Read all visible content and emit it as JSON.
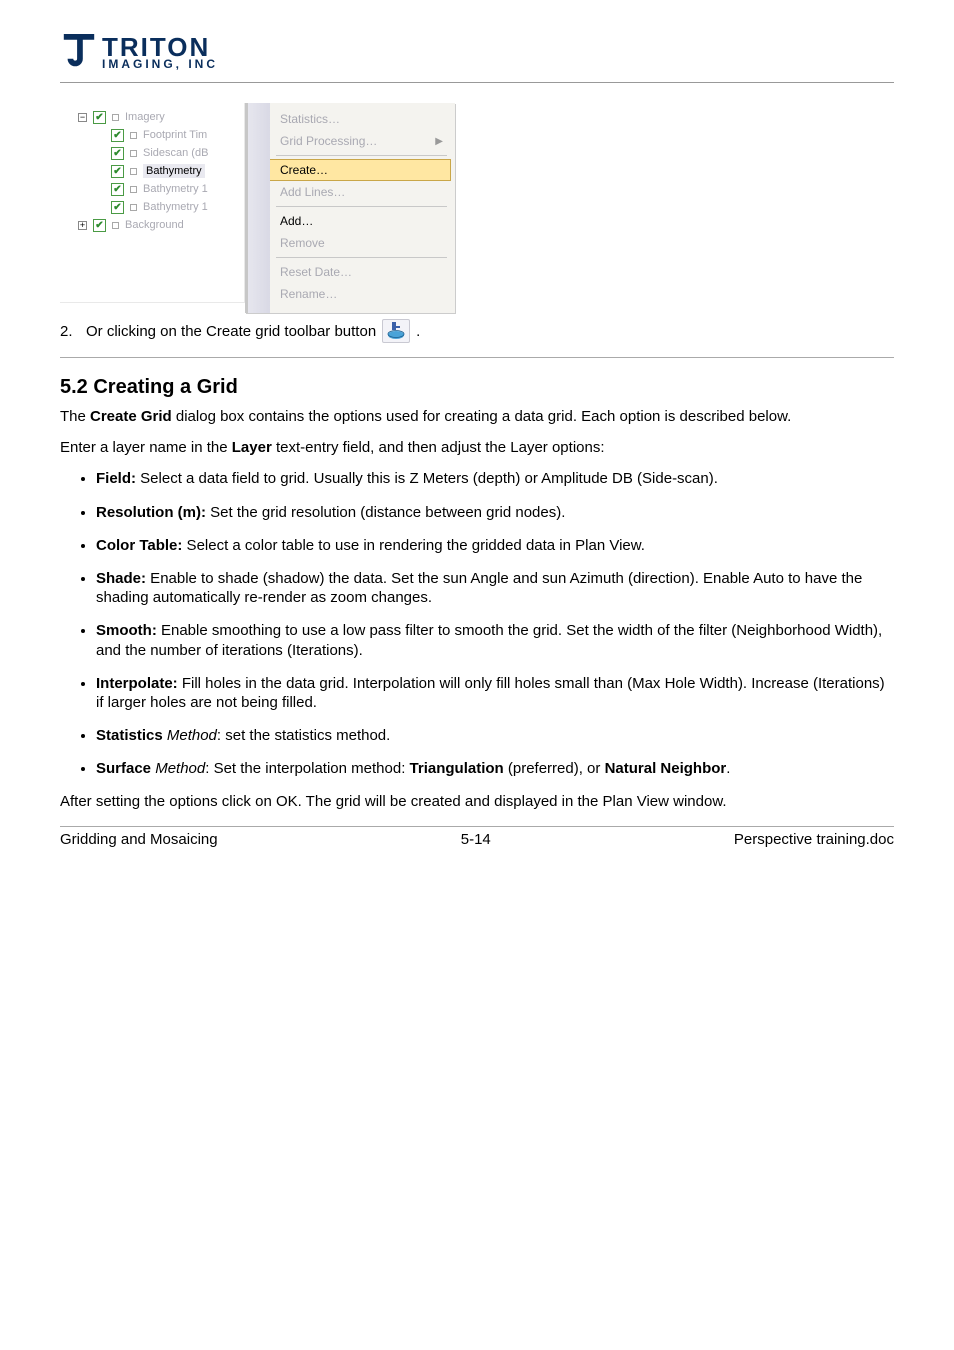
{
  "logo": {
    "main": "TRITON",
    "sub": "IMAGING, INC"
  },
  "tree": {
    "items": [
      {
        "label": "Imagery",
        "toggle": "−",
        "indent": 1
      },
      {
        "label": "Footprint Tim",
        "indent": 2
      },
      {
        "label": "Sidescan (dB",
        "indent": 2
      },
      {
        "label": "Bathymetry",
        "indent": 2,
        "highlight": true
      },
      {
        "label": "Bathymetry 1",
        "indent": 2
      },
      {
        "label": "Bathymetry 1",
        "indent": 2
      },
      {
        "label": "Background",
        "toggle": "+",
        "indent": 1
      }
    ]
  },
  "menu": {
    "items": [
      {
        "label": "Statistics…",
        "enabled": false
      },
      {
        "label": "Grid Processing…",
        "enabled": false,
        "submenu": true
      },
      {
        "sep": true
      },
      {
        "label": "Create…",
        "enabled": true,
        "highlight": true
      },
      {
        "label": "Add Lines…",
        "enabled": false
      },
      {
        "sep": true
      },
      {
        "label": "Add…",
        "enabled": true
      },
      {
        "label": "Remove",
        "enabled": false
      },
      {
        "sep": true
      },
      {
        "label": "Reset Date…",
        "enabled": false
      },
      {
        "label": "Rename…",
        "enabled": false
      }
    ]
  },
  "step2": {
    "num": "2.",
    "text_before": "Or clicking on the Create grid toolbar button ",
    "text_after": "."
  },
  "section": {
    "heading": "5.2 Creating a Grid",
    "p1_a": "The ",
    "p1_b": "Create Grid",
    "p1_c": " dialog box contains the options used for creating a data grid. Each option is described below.",
    "p2_a": "Enter a layer name in the ",
    "p2_b": "Layer",
    "p2_c": " text-entry field, and then adjust the Layer options:",
    "p3": "After setting the options click on OK. The grid will be created and displayed in the Plan View window.",
    "opts": [
      {
        "b": "Field:",
        "rest": " Select a data field to grid. Usually this is Z Meters (depth) or Amplitude DB (Side-scan)."
      },
      {
        "b": "Resolution (m):",
        "rest": " Set the grid resolution (distance between grid nodes)."
      },
      {
        "b": "Color Table:",
        "rest": " Select a color table to use in rendering the gridded data in Plan View."
      },
      {
        "b": "Shade:",
        "rest": " Enable to shade (shadow) the data. Set the sun Angle and sun Azimuth (direction). Enable Auto to have the shading automatically re-render as zoom changes."
      },
      {
        "b": "Smooth:",
        "rest": " Enable smoothing to use a low pass filter to smooth the grid. Set the width of the filter (Neighborhood Width), and the number of iterations (Iterations)."
      },
      {
        "b": "Interpolate:",
        "rest": " Fill holes in the data grid. Interpolation will only fill holes small than (Max Hole Width). Increase (Iterations) if larger holes are not being filled."
      },
      {
        "b": "Statistics",
        "i": " Method",
        "rest": ": set the statistics method."
      },
      {
        "b": "Surface",
        "i": " Method",
        "rest": ": Set the interpolation method: ",
        "trail_b": "Triangulation",
        "trail_rest": " (preferred), or",
        "trail_b2": "Natural Neighbor",
        "trail_rest2": "."
      }
    ]
  },
  "footer": {
    "left": "Gridding and Mosaicing",
    "mid": "5-14",
    "right": "Perspective training.doc"
  }
}
